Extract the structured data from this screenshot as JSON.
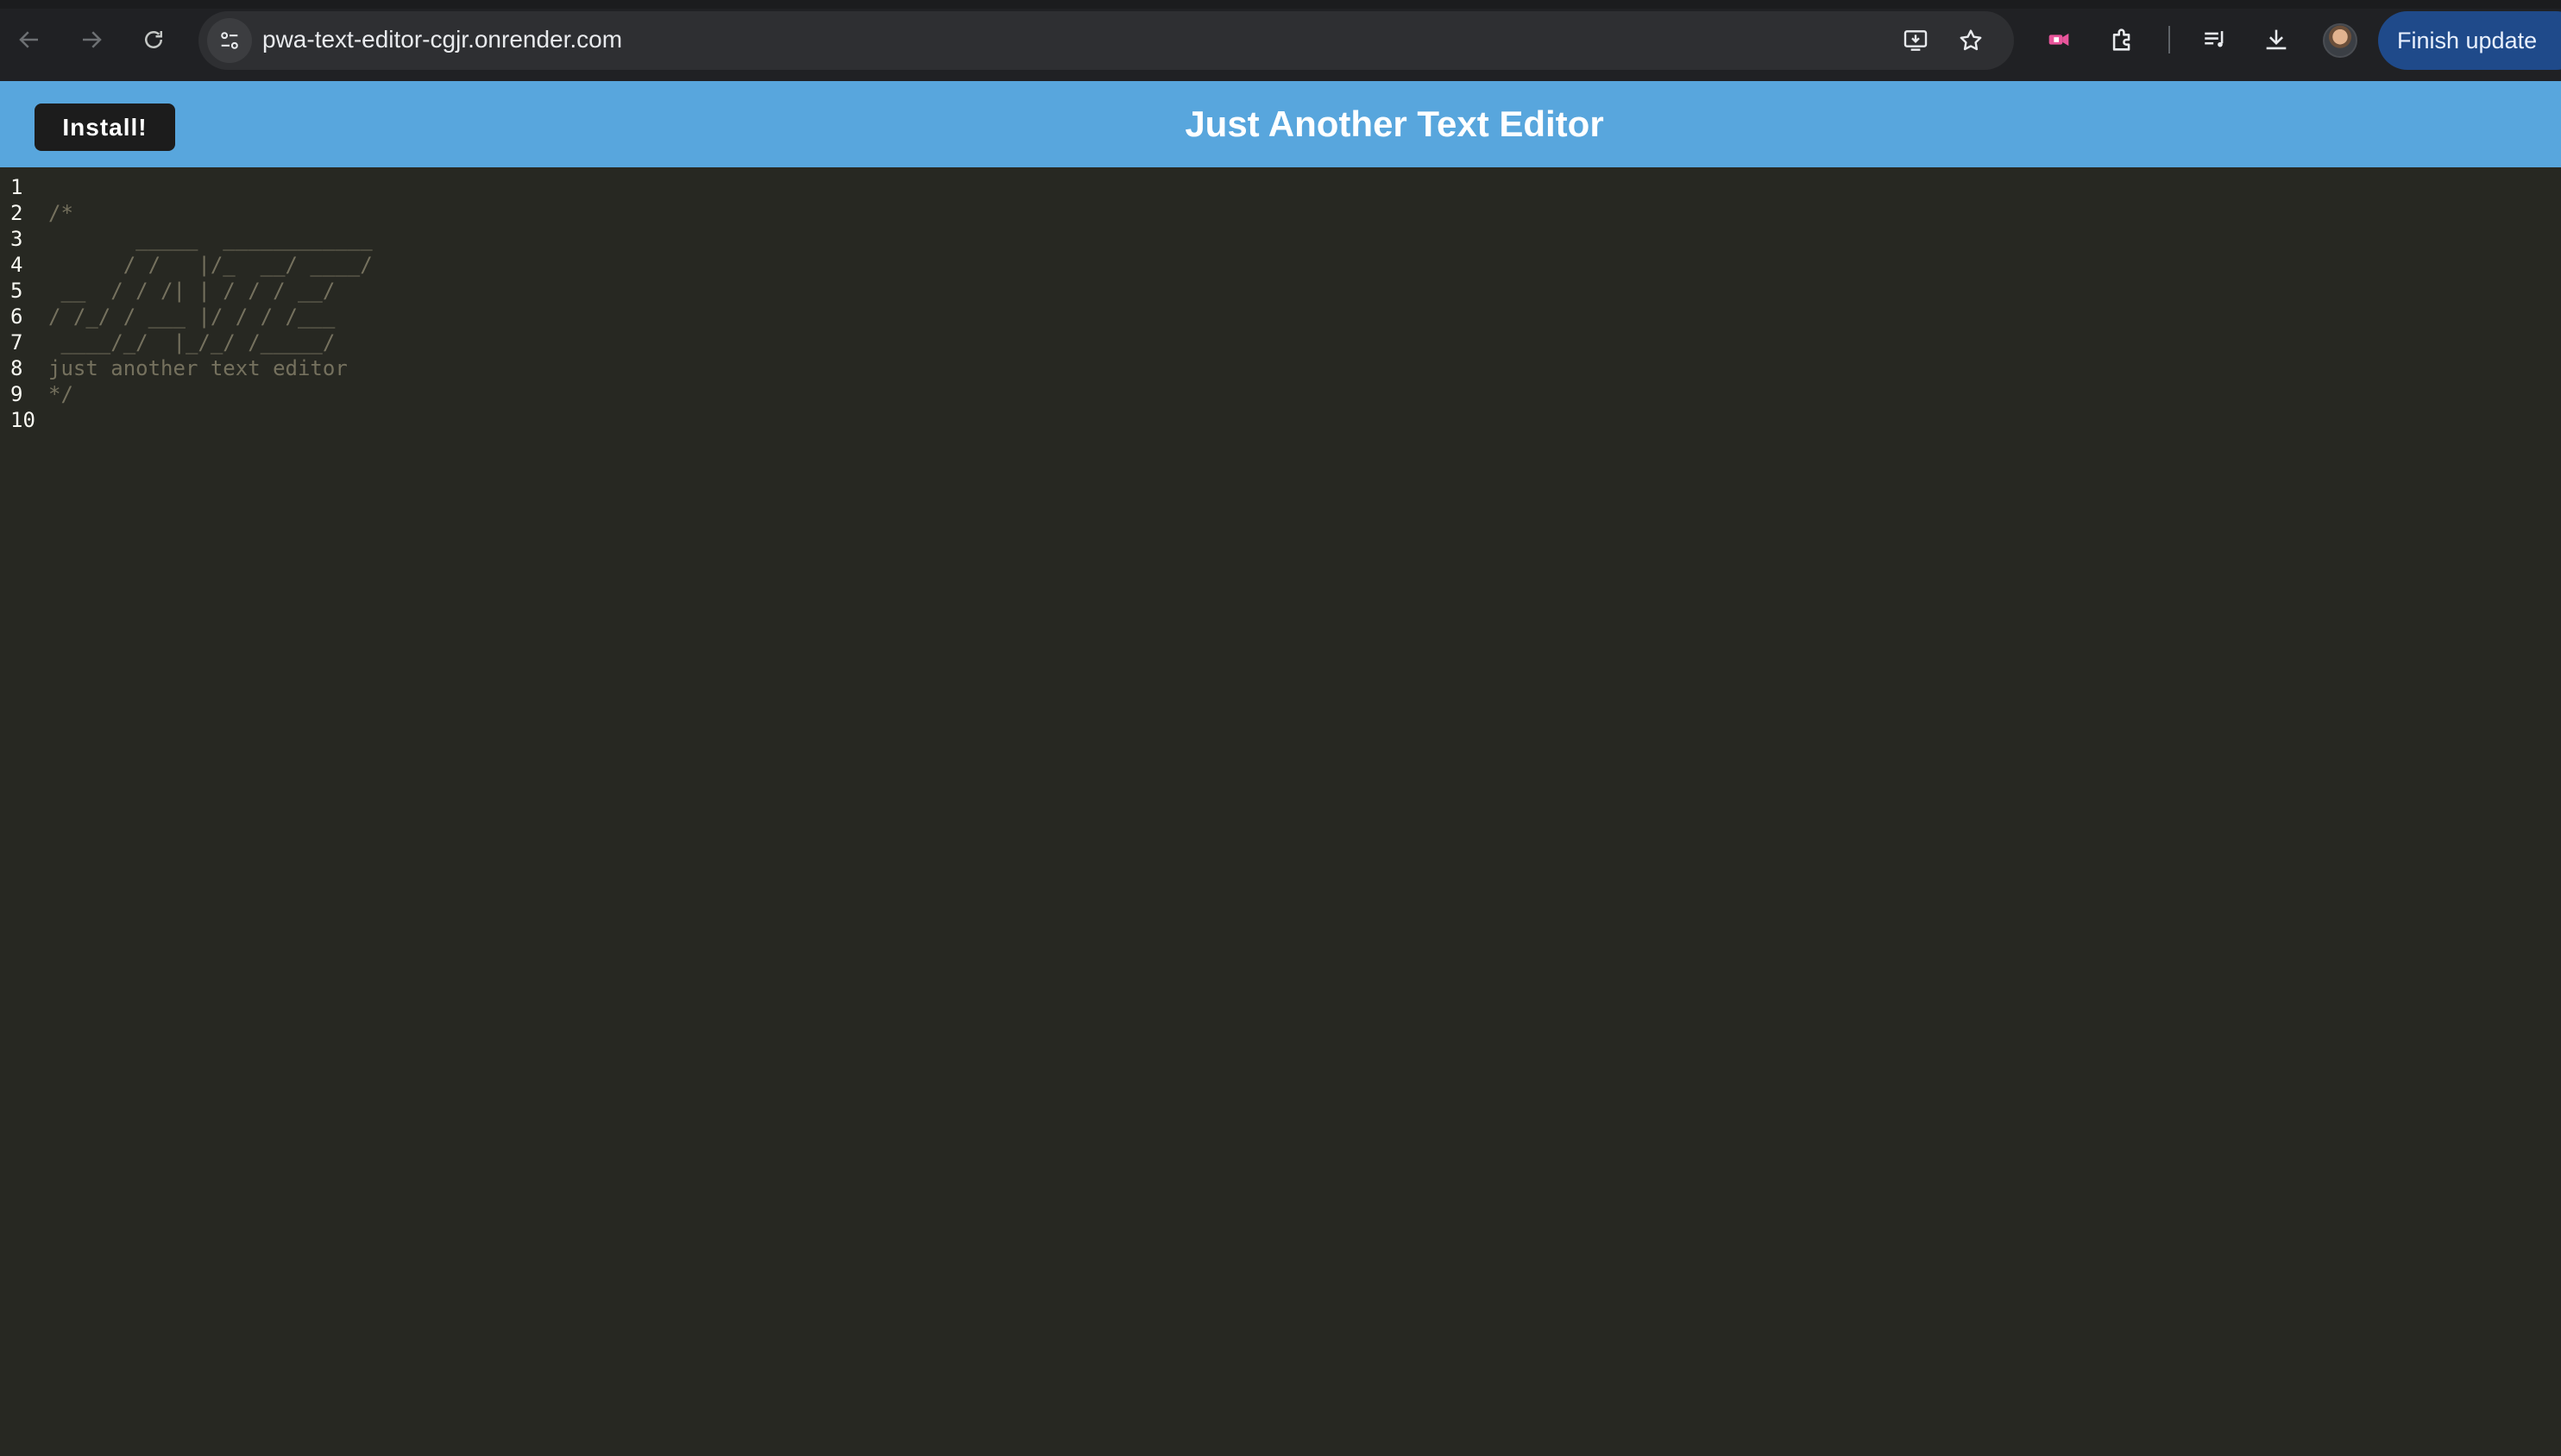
{
  "browser": {
    "url": "pwa-text-editor-cgjr.onrender.com",
    "finish_update_label": "Finish update",
    "icons": [
      "back-arrow-icon",
      "forward-arrow-icon",
      "reload-icon",
      "site-settings-icon",
      "install-app-icon",
      "bookmark-star-icon",
      "extension-pink-icon",
      "puzzle-extensions-icon",
      "media-queue-icon",
      "download-icon"
    ]
  },
  "app": {
    "install_label": "Install!",
    "title": "Just Another Text Editor",
    "header_color": "#58a6dd"
  },
  "editor": {
    "line_numbers": [
      "1",
      "2",
      "3",
      "4",
      "5",
      "6",
      "7",
      "8",
      "9",
      "10"
    ],
    "lines": [
      "",
      "/*",
      "       _____  ____________",
      "      / /   |/_  __/ ____/",
      " __  / / /| | / / / __/",
      "/ /_/ / ___ |/ / / /___",
      " ____/_/  |_/_/ /_____/",
      "just another text editor",
      "*/",
      ""
    ],
    "background": "#272822",
    "comment_color": "#75715e"
  }
}
